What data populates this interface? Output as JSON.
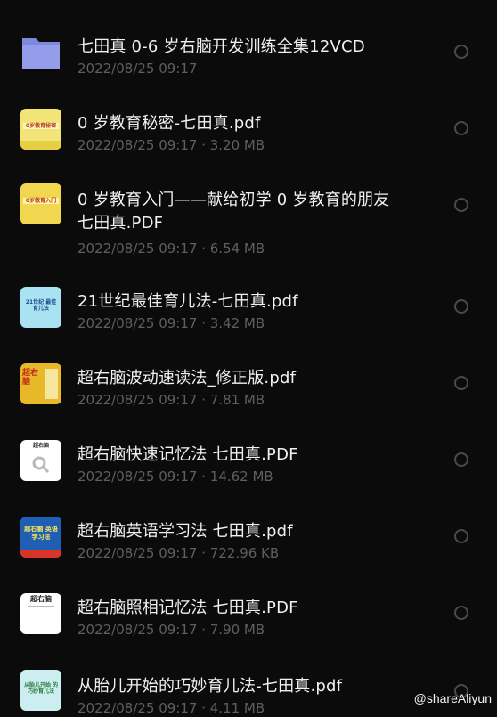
{
  "files": [
    {
      "name": "七田真 0-6 岁右脑开发训练全集12VCD",
      "date": "2022/08/25 09:17",
      "size": "",
      "thumb": "folder-icon"
    },
    {
      "name": "0 岁教育秘密-七田真.pdf",
      "date": "2022/08/25 09:17",
      "size": "3.20 MB",
      "thumb": "book-cover-yellow"
    },
    {
      "name": "0 岁教育入门——献给初学 0 岁教育的朋友\n七田真.PDF",
      "date": "2022/08/25 09:17",
      "size": "6.54 MB",
      "thumb": "book-cover-yellow"
    },
    {
      "name": "21世纪最佳育儿法-七田真.pdf",
      "date": "2022/08/25 09:17",
      "size": "3.42 MB",
      "thumb": "book-cover-cyan"
    },
    {
      "name": "超右脑波动速读法_修正版.pdf",
      "date": "2022/08/25 09:17",
      "size": "7.81 MB",
      "thumb": "book-cover-gold"
    },
    {
      "name": "超右脑快速记忆法 七田真.PDF",
      "date": "2022/08/25 09:17",
      "size": "14.62 MB",
      "thumb": "book-cover-white"
    },
    {
      "name": "超右脑英语学习法 七田真.pdf",
      "date": "2022/08/25 09:17",
      "size": "722.96 KB",
      "thumb": "book-cover-blue"
    },
    {
      "name": "超右脑照相记忆法 七田真.PDF",
      "date": "2022/08/25 09:17",
      "size": "7.90 MB",
      "thumb": "book-cover-white"
    },
    {
      "name": "从胎儿开始的巧妙育儿法-七田真.pdf",
      "date": "2022/08/25 09:17",
      "size": "4.11 MB",
      "thumb": "book-cover-cyan"
    }
  ],
  "cover_text": {
    "cover_1": "0岁教育秘密",
    "cover_2": "0岁教育入门",
    "cover_3": "21世纪 最佳育儿法",
    "cover_4": "超右脑",
    "cover_5": "超右脑",
    "cover_6": "超右脑 英语学习法",
    "cover_7": "超右脑",
    "cover_8": "从胎儿开始 的巧妙育儿法"
  },
  "separator": " · ",
  "watermark": "@shareAliyun",
  "colors": {
    "background": "#0b0b0c",
    "title": "#f1f1f1",
    "meta": "#5f5f63",
    "folder": "#8d95e6"
  }
}
